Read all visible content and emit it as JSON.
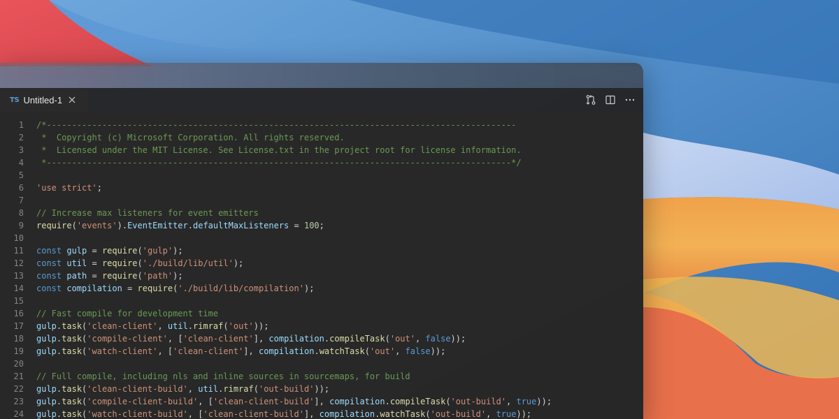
{
  "tab": {
    "language_badge": "TS",
    "title": "Untitled-1"
  },
  "actions": [
    {
      "name": "open-changes-icon"
    },
    {
      "name": "split-editor-icon"
    },
    {
      "name": "more-actions-icon"
    }
  ],
  "colors": {
    "comment": "#6a9955",
    "string": "#ce9178",
    "keyword": "#569cd6",
    "function": "#dcdcaa",
    "variable": "#9cdcfe",
    "number": "#b5cea8",
    "plain": "#d4d4d4",
    "line_number": "#858585"
  },
  "code_lines": [
    [
      [
        "c",
        "/*---------------------------------------------------------------------------------------------"
      ]
    ],
    [
      [
        "c",
        " *  Copyright (c) Microsoft Corporation. All rights reserved."
      ]
    ],
    [
      [
        "c",
        " *  Licensed under the MIT License. See License.txt in the project root for license information."
      ]
    ],
    [
      [
        "c",
        " *--------------------------------------------------------------------------------------------*/"
      ]
    ],
    [],
    [
      [
        "s",
        "'use strict'"
      ],
      [
        "p",
        ";"
      ]
    ],
    [],
    [
      [
        "c",
        "// Increase max listeners for event emitters"
      ]
    ],
    [
      [
        "f",
        "require"
      ],
      [
        "p",
        "("
      ],
      [
        "s",
        "'events'"
      ],
      [
        "p",
        ")."
      ],
      [
        "v",
        "EventEmitter"
      ],
      [
        "p",
        "."
      ],
      [
        "v",
        "defaultMaxListeners"
      ],
      [
        "p",
        " = "
      ],
      [
        "n",
        "100"
      ],
      [
        "p",
        ";"
      ]
    ],
    [],
    [
      [
        "k",
        "const"
      ],
      [
        "p",
        " "
      ],
      [
        "v",
        "gulp"
      ],
      [
        "p",
        " = "
      ],
      [
        "f",
        "require"
      ],
      [
        "p",
        "("
      ],
      [
        "s",
        "'gulp'"
      ],
      [
        "p",
        ");"
      ]
    ],
    [
      [
        "k",
        "const"
      ],
      [
        "p",
        " "
      ],
      [
        "v",
        "util"
      ],
      [
        "p",
        " = "
      ],
      [
        "f",
        "require"
      ],
      [
        "p",
        "("
      ],
      [
        "s",
        "'./build/lib/util'"
      ],
      [
        "p",
        ");"
      ]
    ],
    [
      [
        "k",
        "const"
      ],
      [
        "p",
        " "
      ],
      [
        "v",
        "path"
      ],
      [
        "p",
        " = "
      ],
      [
        "f",
        "require"
      ],
      [
        "p",
        "("
      ],
      [
        "s",
        "'path'"
      ],
      [
        "p",
        ");"
      ]
    ],
    [
      [
        "k",
        "const"
      ],
      [
        "p",
        " "
      ],
      [
        "v",
        "compilation"
      ],
      [
        "p",
        " = "
      ],
      [
        "f",
        "require"
      ],
      [
        "p",
        "("
      ],
      [
        "s",
        "'./build/lib/compilation'"
      ],
      [
        "p",
        ");"
      ]
    ],
    [],
    [
      [
        "c",
        "// Fast compile for development time"
      ]
    ],
    [
      [
        "v",
        "gulp"
      ],
      [
        "p",
        "."
      ],
      [
        "f",
        "task"
      ],
      [
        "p",
        "("
      ],
      [
        "s",
        "'clean-client'"
      ],
      [
        "p",
        ", "
      ],
      [
        "v",
        "util"
      ],
      [
        "p",
        "."
      ],
      [
        "f",
        "rimraf"
      ],
      [
        "p",
        "("
      ],
      [
        "s",
        "'out'"
      ],
      [
        "p",
        "));"
      ]
    ],
    [
      [
        "v",
        "gulp"
      ],
      [
        "p",
        "."
      ],
      [
        "f",
        "task"
      ],
      [
        "p",
        "("
      ],
      [
        "s",
        "'compile-client'"
      ],
      [
        "p",
        ", ["
      ],
      [
        "s",
        "'clean-client'"
      ],
      [
        "p",
        "], "
      ],
      [
        "v",
        "compilation"
      ],
      [
        "p",
        "."
      ],
      [
        "f",
        "compileTask"
      ],
      [
        "p",
        "("
      ],
      [
        "s",
        "'out'"
      ],
      [
        "p",
        ", "
      ],
      [
        "k",
        "false"
      ],
      [
        "p",
        "));"
      ]
    ],
    [
      [
        "v",
        "gulp"
      ],
      [
        "p",
        "."
      ],
      [
        "f",
        "task"
      ],
      [
        "p",
        "("
      ],
      [
        "s",
        "'watch-client'"
      ],
      [
        "p",
        ", ["
      ],
      [
        "s",
        "'clean-client'"
      ],
      [
        "p",
        "], "
      ],
      [
        "v",
        "compilation"
      ],
      [
        "p",
        "."
      ],
      [
        "f",
        "watchTask"
      ],
      [
        "p",
        "("
      ],
      [
        "s",
        "'out'"
      ],
      [
        "p",
        ", "
      ],
      [
        "k",
        "false"
      ],
      [
        "p",
        "));"
      ]
    ],
    [],
    [
      [
        "c",
        "// Full compile, including nls and inline sources in sourcemaps, for build"
      ]
    ],
    [
      [
        "v",
        "gulp"
      ],
      [
        "p",
        "."
      ],
      [
        "f",
        "task"
      ],
      [
        "p",
        "("
      ],
      [
        "s",
        "'clean-client-build'"
      ],
      [
        "p",
        ", "
      ],
      [
        "v",
        "util"
      ],
      [
        "p",
        "."
      ],
      [
        "f",
        "rimraf"
      ],
      [
        "p",
        "("
      ],
      [
        "s",
        "'out-build'"
      ],
      [
        "p",
        "));"
      ]
    ],
    [
      [
        "v",
        "gulp"
      ],
      [
        "p",
        "."
      ],
      [
        "f",
        "task"
      ],
      [
        "p",
        "("
      ],
      [
        "s",
        "'compile-client-build'"
      ],
      [
        "p",
        ", ["
      ],
      [
        "s",
        "'clean-client-build'"
      ],
      [
        "p",
        "], "
      ],
      [
        "v",
        "compilation"
      ],
      [
        "p",
        "."
      ],
      [
        "f",
        "compileTask"
      ],
      [
        "p",
        "("
      ],
      [
        "s",
        "'out-build'"
      ],
      [
        "p",
        ", "
      ],
      [
        "k",
        "true"
      ],
      [
        "p",
        "));"
      ]
    ],
    [
      [
        "v",
        "gulp"
      ],
      [
        "p",
        "."
      ],
      [
        "f",
        "task"
      ],
      [
        "p",
        "("
      ],
      [
        "s",
        "'watch-client-build'"
      ],
      [
        "p",
        ", ["
      ],
      [
        "s",
        "'clean-client-build'"
      ],
      [
        "p",
        "], "
      ],
      [
        "v",
        "compilation"
      ],
      [
        "p",
        "."
      ],
      [
        "f",
        "watchTask"
      ],
      [
        "p",
        "("
      ],
      [
        "s",
        "'out-build'"
      ],
      [
        "p",
        ", "
      ],
      [
        "k",
        "true"
      ],
      [
        "p",
        "));"
      ]
    ]
  ]
}
